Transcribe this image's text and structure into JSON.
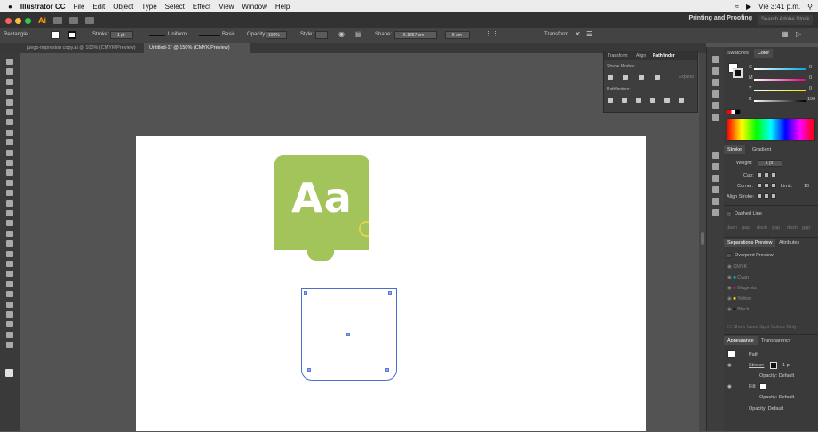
{
  "macbar": {
    "apple": "",
    "app": "Illustrator CC",
    "menus": [
      "File",
      "Edit",
      "Object",
      "Type",
      "Select",
      "Effect",
      "View",
      "Window",
      "Help"
    ],
    "time": "Vie 3:41 p.m."
  },
  "appbar": {
    "logo": "Ai",
    "workspace": "Printing and Proofing",
    "search_placeholder": "Search Adobe Stock"
  },
  "control": {
    "selection": "Rectangle",
    "stroke_label": "Stroke:",
    "stroke_value": "1 pt",
    "profile": "Uniform",
    "brush": "Basic",
    "opacity_label": "Opacity:",
    "opacity_value": "100%",
    "style_label": "Style:",
    "shape_label": "Shape:",
    "width": "5.1857 cm",
    "height": "5 cm",
    "transform_label": "Transform"
  },
  "tabs": [
    "juego-impresion copy.ai @ 100% (CMYK/Preview)",
    "Untitled-1* @ 150% (CMYK/Preview)"
  ],
  "artwork": {
    "text": "Aa",
    "card_color": "#a2c45a",
    "ring_color": "#e5d34a",
    "selection_color": "#4a6fd1"
  },
  "pathfinder": {
    "tabs": [
      "Transform",
      "Align",
      "Pathfinder"
    ],
    "shape_modes": "Shape Modes:",
    "expand": "Expand",
    "pathfinders": "Pathfinders:"
  },
  "swatches": {
    "tabs": [
      "Swatches",
      "Color"
    ],
    "channels": [
      {
        "label": "C",
        "value": "0"
      },
      {
        "label": "M",
        "value": "0"
      },
      {
        "label": "Y",
        "value": "0"
      },
      {
        "label": "K",
        "value": "100"
      }
    ]
  },
  "stroke": {
    "tabs": [
      "Stroke",
      "Gradient"
    ],
    "weight_label": "Weight:",
    "weight_value": "1 pt",
    "cap_label": "Cap:",
    "corner_label": "Corner:",
    "limit_label": "Limit:",
    "limit_value": "10",
    "align_label": "Align Stroke:",
    "dashed": "Dashed Line",
    "dash_fields": [
      "dash",
      "gap",
      "dash",
      "gap",
      "dash",
      "gap"
    ]
  },
  "separations": {
    "tabs": [
      "Separations Preview",
      "Attributes"
    ],
    "overprint": "Overprint Preview",
    "inks": [
      {
        "name": "CMYK",
        "color": "#888888"
      },
      {
        "name": "Cyan",
        "color": "#00a8e8"
      },
      {
        "name": "Magenta",
        "color": "#e8007f"
      },
      {
        "name": "Yellow",
        "color": "#f4e400"
      },
      {
        "name": "Black",
        "color": "#111111"
      }
    ],
    "spot_only": "Show Used Spot Colors Only"
  },
  "appearance": {
    "tabs": [
      "Appearance",
      "Transparency"
    ],
    "path": "Path",
    "stroke_label": "Stroke:",
    "stroke_value": "1 pt",
    "opacity1": "Opacity: Default",
    "fill_label": "Fill:",
    "opacity2": "Opacity: Default",
    "opacity3": "Opacity: Default"
  }
}
